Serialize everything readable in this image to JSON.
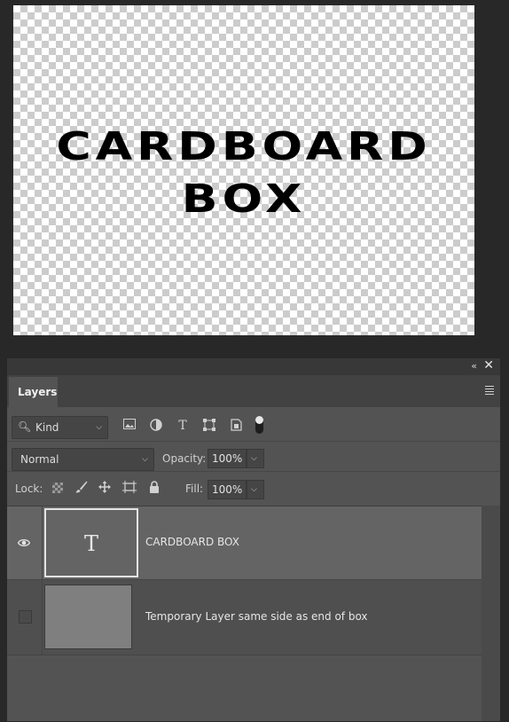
{
  "canvas": {
    "text_lines": [
      "CARDBOARD",
      "BOX"
    ]
  },
  "panel": {
    "tab_label": "Layers",
    "filter": {
      "kind_label": "Kind"
    },
    "blend": {
      "mode": "Normal",
      "opacity_label": "Opacity:",
      "opacity_value": "100%"
    },
    "lock": {
      "lock_label": "Lock:",
      "fill_label": "Fill:",
      "fill_value": "100%"
    },
    "layers": [
      {
        "name": "CARDBOARD BOX",
        "thumb_glyph": "T",
        "visible": true,
        "selected": true
      },
      {
        "name": "Temporary Layer same side as end of box",
        "visible": false,
        "selected": false
      }
    ]
  },
  "colors": {
    "app_background": "#282828",
    "panel_background": "#535353",
    "selected_row": "#646464",
    "text": "#e6e6e6"
  },
  "icons": [
    "collapse-icon",
    "close-icon",
    "panel-menu-icon",
    "search-icon",
    "image-filter-icon",
    "adjustment-filter-icon",
    "type-filter-icon",
    "shape-filter-icon",
    "smart-object-filter-icon",
    "filter-toggle-icon",
    "lock-transparent-icon",
    "lock-brush-icon",
    "lock-move-icon",
    "lock-artboard-icon",
    "lock-all-icon",
    "eye-icon"
  ]
}
